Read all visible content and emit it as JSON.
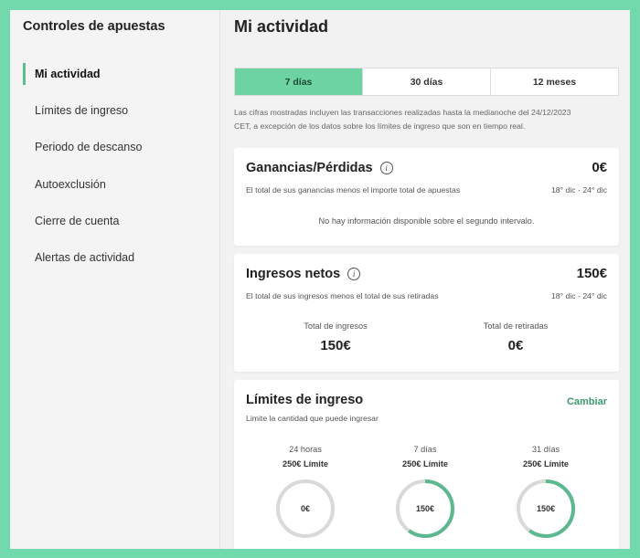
{
  "sidebar": {
    "title": "Controles de apuestas",
    "items": [
      {
        "label": "Mi actividad",
        "active": true
      },
      {
        "label": "Límites de ingreso"
      },
      {
        "label": "Periodo de descanso"
      },
      {
        "label": "Autoexclusión"
      },
      {
        "label": "Cierre de cuenta"
      },
      {
        "label": "Alertas de actividad"
      }
    ]
  },
  "main": {
    "title": "Mi actividad",
    "tabs": [
      {
        "label": "7 días",
        "active": true
      },
      {
        "label": "30 días"
      },
      {
        "label": "12 meses"
      }
    ],
    "notice_line1": "Las cifras mostradas incluyen las transacciones realizadas hasta la medianoche del 24/12/2023",
    "notice_line2": "CET, a excepción de los datos sobre los límites de ingreso que son en tiempo real."
  },
  "winloss": {
    "title": "Ganancias/Pérdidas",
    "amount": "0€",
    "description": "El total de sus ganancias menos el importe total de apuestas",
    "range": "18° dic - 24° dic",
    "no_info": "No hay información disponible sobre el segundo intervalo."
  },
  "net_deposits": {
    "title": "Ingresos netos",
    "amount": "150€",
    "description": "El total de sus ingresos menos el total de sus retiradas",
    "range": "18° dic - 24° dic",
    "deposits_label": "Total de ingresos",
    "deposits_value": "150€",
    "withdrawals_label": "Total de retiradas",
    "withdrawals_value": "0€"
  },
  "limits": {
    "title": "Límites de ingreso",
    "change_label": "Cambiar",
    "description": "Limite la cantidad que puede ingresar",
    "items": [
      {
        "period": "24 horas",
        "limit": "250€ Límite",
        "used": "0€",
        "fraction": 0
      },
      {
        "period": "7 días",
        "limit": "250€ Límite",
        "used": "150€",
        "fraction": 0.6
      },
      {
        "period": "31 días",
        "limit": "250€ Límite",
        "used": "150€",
        "fraction": 0.6
      }
    ]
  },
  "colors": {
    "accent": "#6dd3a3",
    "ring_fill": "#5cb88f",
    "ring_track": "#d9d9d9",
    "link": "#3a9a6d"
  }
}
